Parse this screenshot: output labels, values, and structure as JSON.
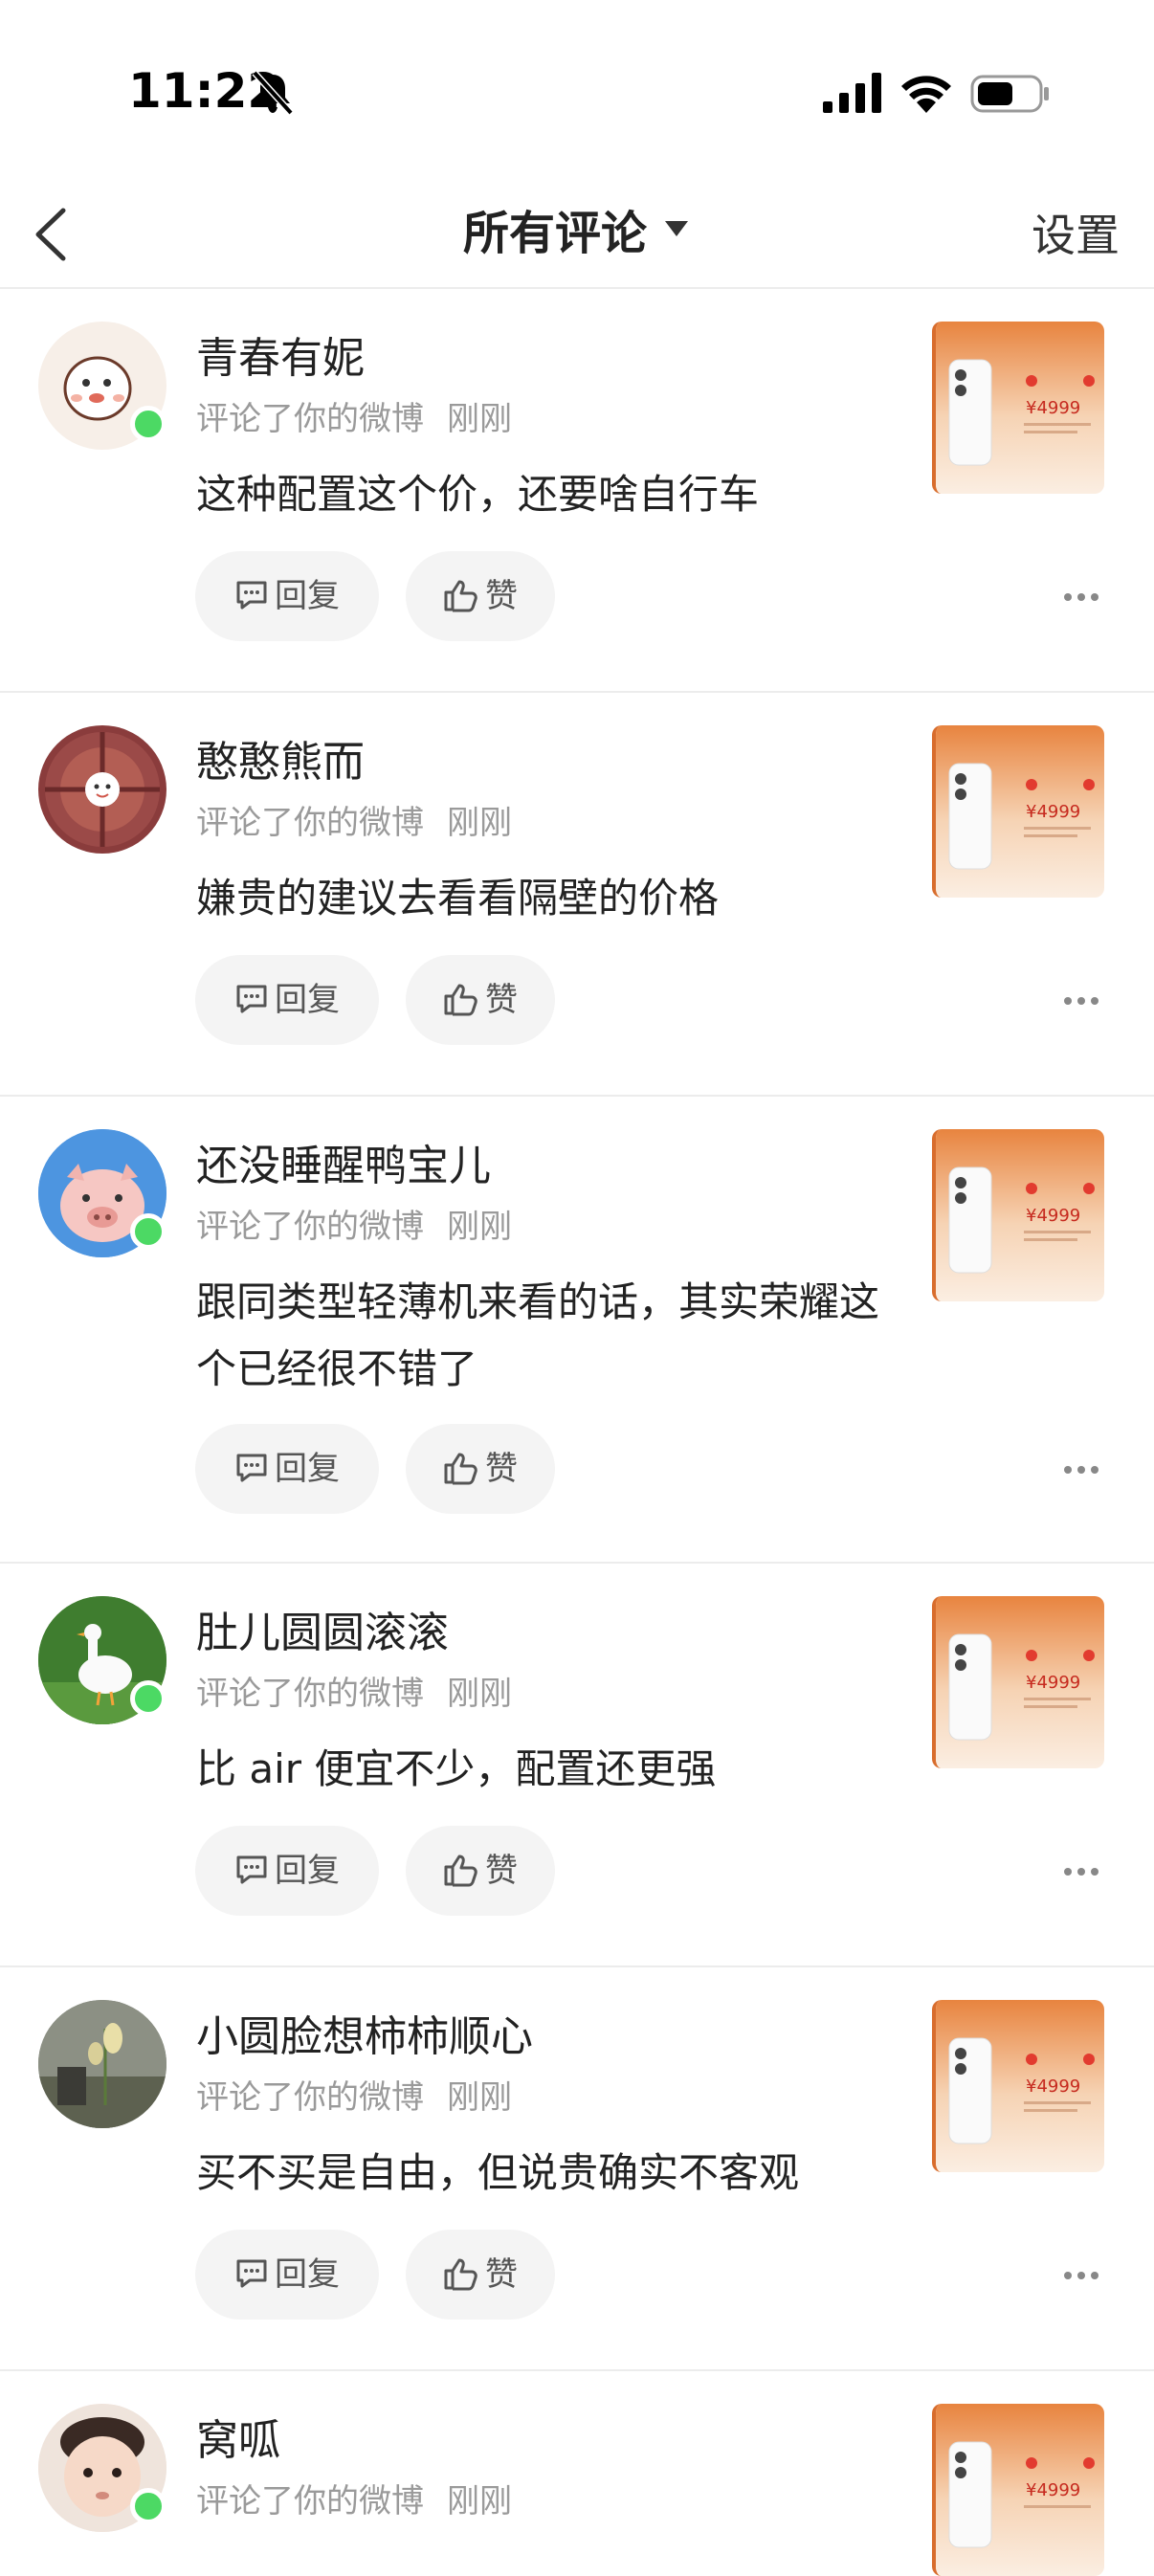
{
  "status_bar": {
    "time": "11:22"
  },
  "nav": {
    "title": "所有评论",
    "right_label": "设置"
  },
  "common": {
    "reply_label": "回复",
    "like_label": "赞",
    "price_text": "¥4999"
  },
  "comments": [
    {
      "name": "青春有妮",
      "action": "评论了你的微博",
      "time": "刚刚",
      "text": "这种配置这个价，还要啥自行车",
      "online": true
    },
    {
      "name": "憨憨熊而",
      "action": "评论了你的微博",
      "time": "刚刚",
      "text": "嫌贵的建议去看看隔壁的价格",
      "online": false
    },
    {
      "name": "还没睡醒鸭宝儿",
      "action": "评论了你的微博",
      "time": "刚刚",
      "text": "跟同类型轻薄机来看的话，其实荣耀这个已经很不错了",
      "online": true
    },
    {
      "name": "肚儿圆圆滚滚",
      "action": "评论了你的微博",
      "time": "刚刚",
      "text": "比 air 便宜不少，配置还更强",
      "online": true
    },
    {
      "name": "小圆脸想柿柿顺心",
      "action": "评论了你的微博",
      "time": "刚刚",
      "text": "买不买是自由，但说贵确实不客观",
      "online": false
    },
    {
      "name": "窝呱",
      "action": "评论了你的微博",
      "time": "刚刚",
      "text": "",
      "online": true
    }
  ],
  "colors": {
    "online": "#4cd964",
    "thumb_orange": "#e8843f",
    "divider": "#ececec"
  }
}
